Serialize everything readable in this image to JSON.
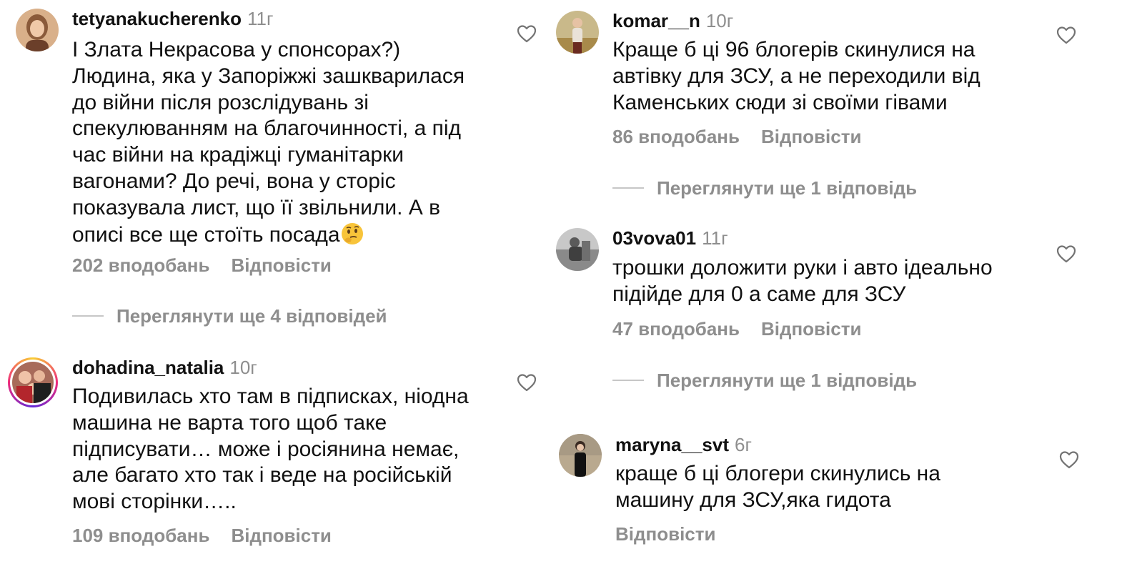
{
  "comments_left": [
    {
      "username": "tetyanakucherenko",
      "time": "11г",
      "text_lines": [
        "І Злата Некрасова у спонсорах?)",
        "Людина, яка у Запоріжжі зашкварилася",
        "до війни після розслідувань зі",
        "спекулюванням на благочинності, а під",
        "час війни на крадіжці гуманітарки",
        "вагонами? До речі, вона у сторіс",
        "показувала лист, що її звільнили. А в",
        "описі все ще стоїть посада"
      ],
      "emoji": "thinking-face",
      "likes": "202 вподобань",
      "reply": "Відповісти",
      "thread": "Переглянути ще 4 відповідей"
    },
    {
      "username": "dohadina_natalia",
      "time": "10г",
      "text_lines": [
        "Подивилась хто там в підписках, ніодна",
        "машина не варта того щоб таке",
        "підписувати… може і росіянина немає,",
        "але багато хто так і веде на російській",
        "мові сторінки….."
      ],
      "likes": "109 вподобань",
      "reply": "Відповісти"
    }
  ],
  "comments_right": [
    {
      "username": "komar__n",
      "time": "10г",
      "text_lines": [
        "Краще б ці 96 блогерів скинулися на",
        "автівку для ЗСУ, а не переходили від",
        "Каменських сюди зі своїми гівами"
      ],
      "likes": "86 вподобань",
      "reply": "Відповісти",
      "thread": "Переглянути ще 1 відповідь"
    },
    {
      "username": "03vova01",
      "time": "11г",
      "text_lines": [
        "трошки доложити руки і авто ідеально",
        "підійде для 0  а саме для ЗСУ"
      ],
      "likes": "47 вподобань",
      "reply": "Відповісти",
      "thread": "Переглянути ще 1 відповідь"
    },
    {
      "username": "maryna__svt",
      "time": "6г",
      "text_lines": [
        "краще б ці блогери скинулись на",
        "машину для ЗСУ,яка гидота"
      ],
      "reply": "Відповісти"
    }
  ],
  "icons": {
    "like": "heart-outline-icon",
    "emoji": "thinking-face-emoji"
  },
  "colors": {
    "text": "#111111",
    "muted": "#8e8e8e",
    "story_ring": [
      "#f9ce34",
      "#ee2a7b",
      "#6228d7"
    ]
  }
}
